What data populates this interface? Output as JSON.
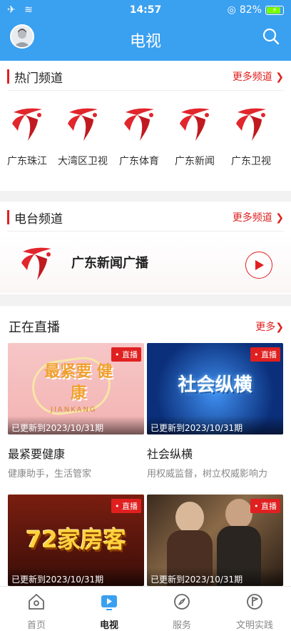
{
  "status_bar": {
    "time": "14:57",
    "battery": "82%"
  },
  "header": {
    "title": "电视"
  },
  "hot_channels": {
    "title": "热门频道",
    "more": "更多频道",
    "items": [
      {
        "name": "广东珠江"
      },
      {
        "name": "大湾区卫视"
      },
      {
        "name": "广东体育"
      },
      {
        "name": "广东新闻"
      },
      {
        "name": "广东卫视"
      }
    ]
  },
  "radio_channels": {
    "title": "电台频道",
    "more": "更多频道",
    "items": [
      {
        "name": "广东新闻广播"
      }
    ]
  },
  "live": {
    "title": "正在直播",
    "more": "更多",
    "badge": "直播",
    "items": [
      {
        "name": "最紧要健康",
        "desc": "健康助手，生活管家",
        "updated": "已更新到2023/10/31期",
        "thumb_text": "最紧要 健康",
        "thumb_sub": "JIANKANG"
      },
      {
        "name": "社会纵横",
        "desc": "用权威监督，树立权威影响力",
        "updated": "已更新到2023/10/31期",
        "thumb_text": "社会纵横"
      },
      {
        "name": "",
        "desc": "",
        "updated": "已更新到2023/10/31期",
        "thumb_text": "72家房客"
      },
      {
        "name": "",
        "desc": "",
        "updated": "已更新到2023/10/31期",
        "thumb_text": ""
      }
    ]
  },
  "tabbar": {
    "items": [
      {
        "label": "首页",
        "icon": "home-icon"
      },
      {
        "label": "电视",
        "icon": "tv-icon",
        "active": true
      },
      {
        "label": "服务",
        "icon": "compass-icon"
      },
      {
        "label": "文明实践",
        "icon": "flag-badge-icon"
      }
    ]
  },
  "colors": {
    "primary": "#3aa0f0",
    "accent": "#e02020"
  }
}
